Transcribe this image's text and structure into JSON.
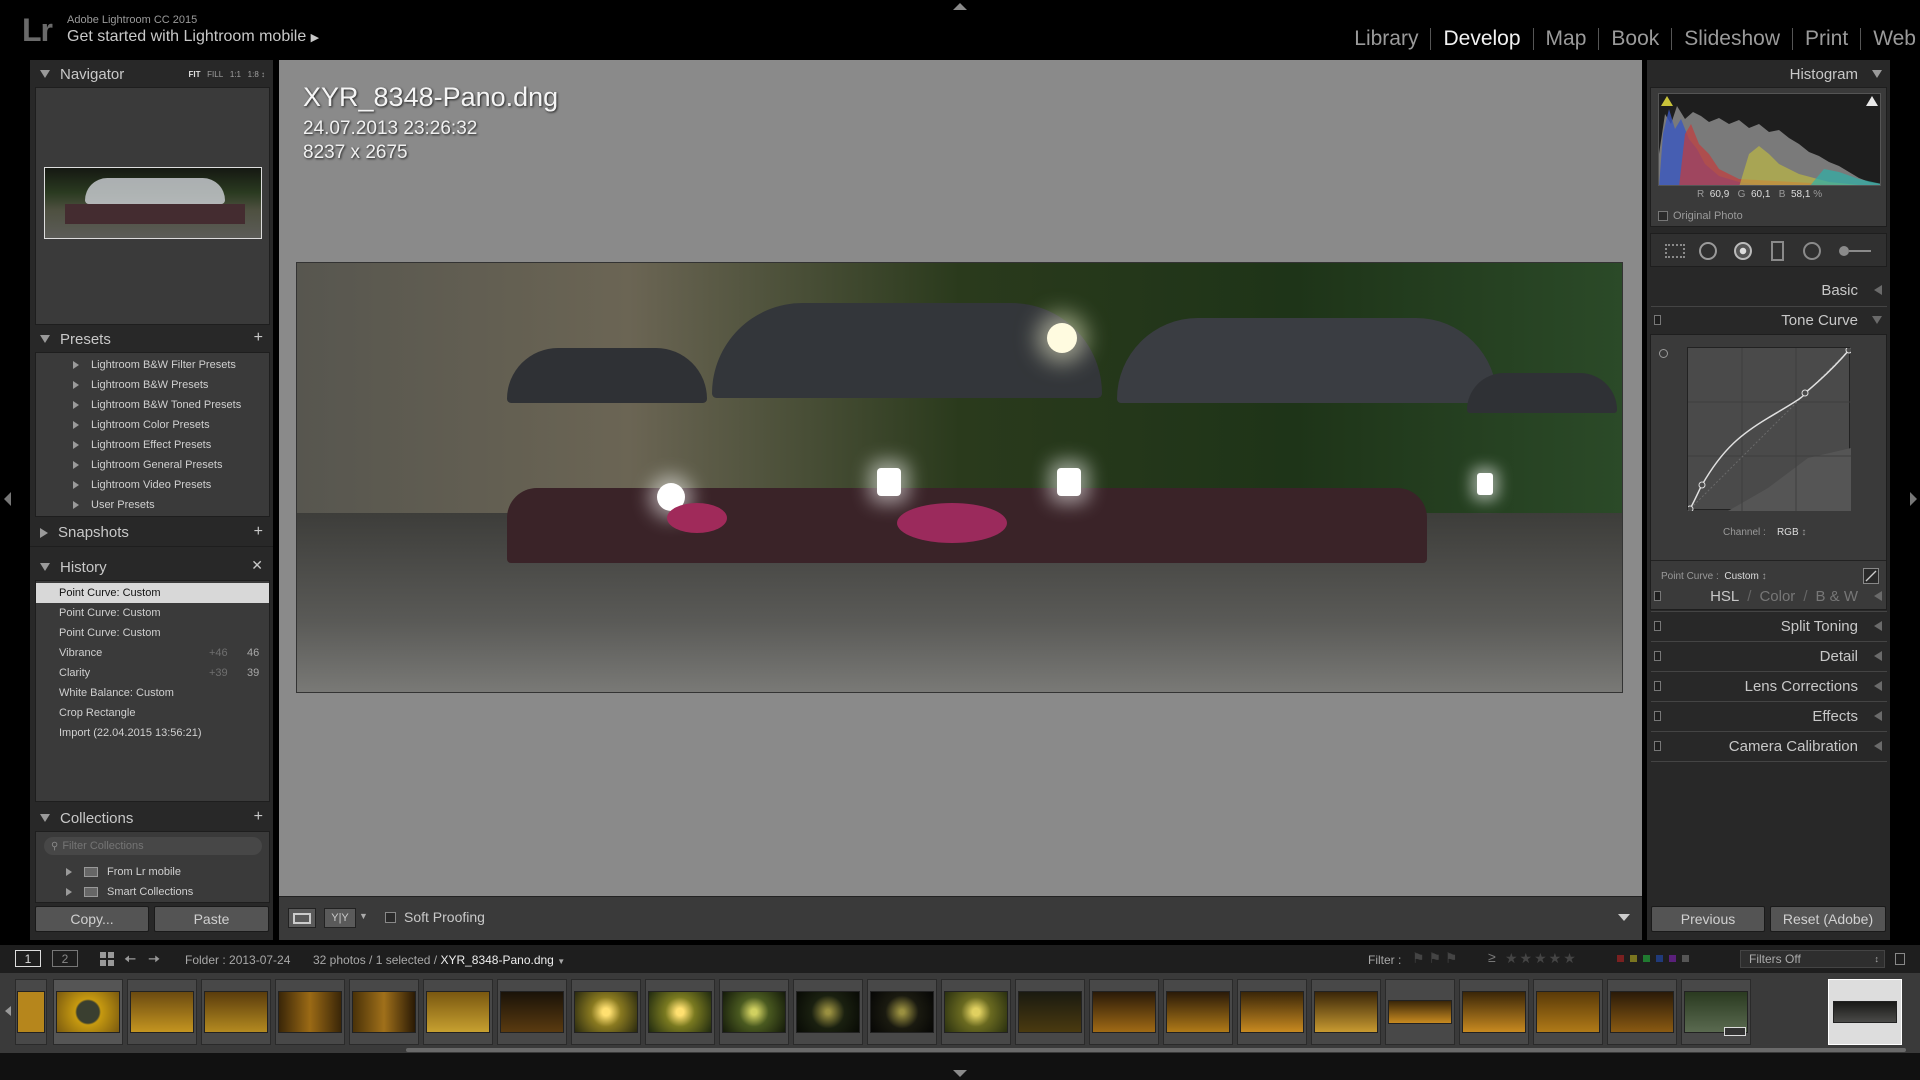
{
  "app": {
    "name": "Adobe Lightroom CC 2015",
    "logo": "Lr",
    "mobile_prompt": "Get started with Lightroom mobile"
  },
  "modules": [
    "Library",
    "Develop",
    "Map",
    "Book",
    "Slideshow",
    "Print",
    "Web"
  ],
  "active_module": "Develop",
  "navigator": {
    "title": "Navigator",
    "zoom_options": [
      "FIT",
      "FILL",
      "1:1",
      "1:8"
    ]
  },
  "presets": {
    "title": "Presets",
    "items": [
      "Lightroom B&W Filter Presets",
      "Lightroom B&W Presets",
      "Lightroom B&W Toned Presets",
      "Lightroom Color Presets",
      "Lightroom Effect Presets",
      "Lightroom General Presets",
      "Lightroom Video Presets",
      "User Presets"
    ]
  },
  "snapshots": {
    "title": "Snapshots"
  },
  "history": {
    "title": "History",
    "items": [
      {
        "label": "Point Curve: Custom",
        "from": "",
        "to": "",
        "selected": true
      },
      {
        "label": "Point Curve: Custom",
        "from": "",
        "to": ""
      },
      {
        "label": "Point Curve: Custom",
        "from": "",
        "to": ""
      },
      {
        "label": "Vibrance",
        "from": "+46",
        "to": "46"
      },
      {
        "label": "Clarity",
        "from": "+39",
        "to": "39"
      },
      {
        "label": "White Balance: Custom",
        "from": "",
        "to": ""
      },
      {
        "label": "Crop Rectangle",
        "from": "",
        "to": ""
      },
      {
        "label": "Import (22.04.2015 13:56:21)",
        "from": "",
        "to": ""
      }
    ]
  },
  "collections": {
    "title": "Collections",
    "filter_placeholder": "Filter Collections",
    "items": [
      "From Lr mobile",
      "Smart Collections"
    ]
  },
  "left_buttons": {
    "copy": "Copy...",
    "paste": "Paste"
  },
  "image": {
    "filename": "XYR_8348-Pano.dng",
    "datetime": "24.07.2013 23:26:32",
    "dimensions": "8237 x 2675"
  },
  "toolbar": {
    "soft_proofing": "Soft Proofing",
    "view_compare": "Y|Y"
  },
  "histogram": {
    "title": "Histogram",
    "r_label": "R",
    "r_value": "60,9",
    "g_label": "G",
    "g_value": "60,1",
    "b_label": "B",
    "b_value": "58,1",
    "unit": "%",
    "original_photo": "Original Photo"
  },
  "right_panels": {
    "basic": "Basic",
    "tone_curve": "Tone Curve",
    "channel_label": "Channel :",
    "channel_value": "RGB",
    "point_curve_label": "Point Curve :",
    "point_curve_value": "Custom",
    "hsl": "HSL",
    "color": "Color",
    "bw": "B & W",
    "split_toning": "Split Toning",
    "detail": "Detail",
    "lens_corrections": "Lens Corrections",
    "effects": "Effects",
    "camera_calibration": "Camera Calibration"
  },
  "right_buttons": {
    "previous": "Previous",
    "reset": "Reset (Adobe)"
  },
  "filmbar": {
    "screen1": "1",
    "screen2": "2",
    "folder": "Folder : 2013-07-24",
    "count": "32 photos / 1 selected /",
    "selected_file": "XYR_8348-Pano.dng",
    "filter_label": "Filter :",
    "filters_off": "Filters Off"
  },
  "colors": {
    "accent": "#f2f2f2",
    "panel_bg": "#282828",
    "center_bg": "#8a8a8a"
  }
}
